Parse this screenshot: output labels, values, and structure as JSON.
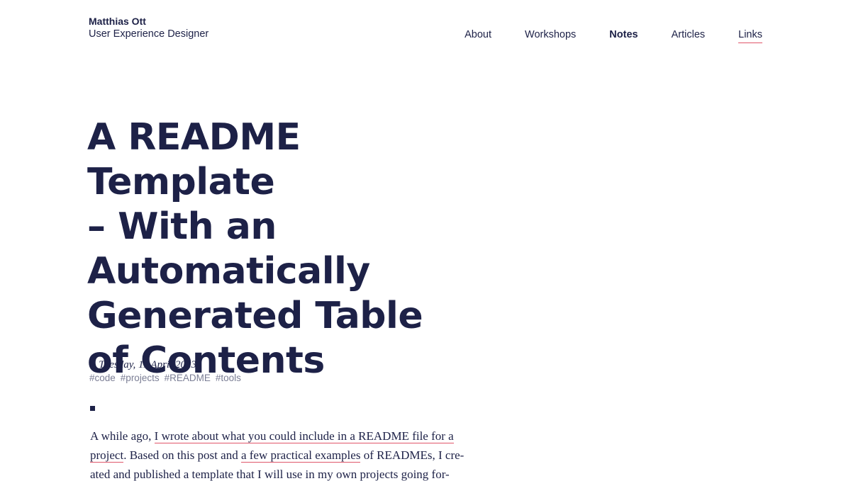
{
  "header": {
    "name": "Matthias Ott",
    "role": "User Experience Designer",
    "nav": [
      {
        "label": "About"
      },
      {
        "label": "Workshops"
      },
      {
        "label": "Notes"
      },
      {
        "label": "Articles"
      },
      {
        "label": "Links"
      }
    ]
  },
  "post": {
    "title_lines": [
      "A README Template",
      "– With an",
      "Automatically",
      "Generated Table",
      "of Contents"
    ],
    "date": "Tuesday, 11 April 2023",
    "tags": [
      "#code",
      "#projects",
      "#README",
      "#tools"
    ],
    "body": {
      "intro": "A while ago, ",
      "link1_line1": "I wrote about what you could include in a README file for a",
      "link1_line2": "project",
      "mid1": ". Based on this post and ",
      "link2": "a few practical examples",
      "mid2": " of READMEs, I cre-",
      "line3": "ated and published a template that I will use in my own projects going for-"
    }
  },
  "icons": {
    "date_icon": "pencil-icon"
  },
  "colors": {
    "text": "#1d2147",
    "accent": "#e0566a",
    "tag": "#7b7e95"
  }
}
